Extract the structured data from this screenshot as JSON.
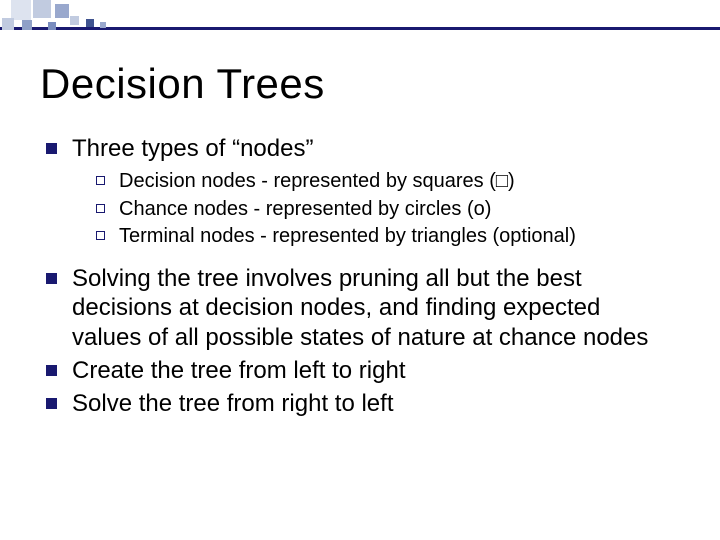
{
  "title": "Decision Trees",
  "bullets": [
    {
      "text": "Three types of “nodes”",
      "sub": [
        "Decision nodes - represented by squares (□)",
        "Chance nodes - represented by circles (ο)",
        "Terminal nodes - represented by triangles  (optional)"
      ]
    },
    {
      "text": "Solving the tree involves pruning all but the best decisions at decision nodes, and finding expected values of all possible states of nature at chance nodes"
    },
    {
      "text": "Create the tree from left to right"
    },
    {
      "text": "Solve the tree from right to left"
    }
  ],
  "colors": {
    "accent": "#191970"
  }
}
